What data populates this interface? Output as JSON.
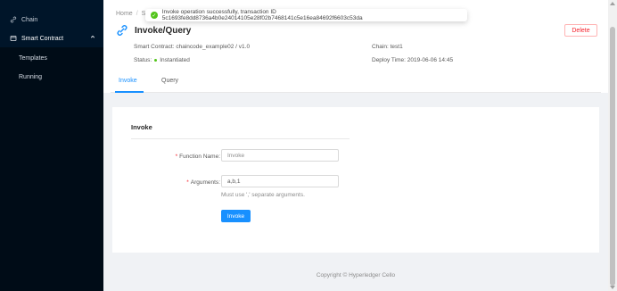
{
  "sidebar": {
    "items": [
      {
        "label": "Chain",
        "icon": "link-icon"
      },
      {
        "label": "Smart Contract",
        "icon": "contract-icon",
        "expanded": true
      }
    ],
    "submenu": [
      {
        "label": "Templates"
      },
      {
        "label": "Running"
      }
    ]
  },
  "breadcrumb": {
    "home": "Home",
    "sep": "/",
    "partial": "Sr"
  },
  "page": {
    "title": "Invoke/Query",
    "delete_label": "Delete"
  },
  "info": {
    "smart_contract_label": "Smart Contract:",
    "smart_contract_value": "chaincode_example02 / v1.0",
    "status_label": "Status:",
    "status_value": "Instantiated",
    "chain_label": "Chain:",
    "chain_value": "test1",
    "deploy_time_label": "Deploy Time:",
    "deploy_time_value": "2019-06-06 14:45"
  },
  "tabs": [
    {
      "label": "Invoke",
      "active": true
    },
    {
      "label": "Query",
      "active": false
    }
  ],
  "form": {
    "card_title": "Invoke",
    "function_label": "Function Name",
    "function_colon": ":",
    "function_placeholder": "Invoke",
    "arguments_label": "Arguments",
    "arguments_colon": ":",
    "arguments_value": "a,b,1",
    "hint": "Must use ',' separate arguments.",
    "submit_label": "Invoke"
  },
  "footer": {
    "copyright": "Copyright",
    "brand": "Hyperledger Cello"
  },
  "toast": {
    "message": "Invoke operation successfully, transaction ID 5c1693fe8dd8736a4b0e24014105e28f02b7468141c5e16ea84692f6603c53da"
  },
  "colors": {
    "primary": "#1890ff",
    "sidebar_bg": "#001529",
    "success": "#52c41a",
    "danger": "#f5222d"
  }
}
